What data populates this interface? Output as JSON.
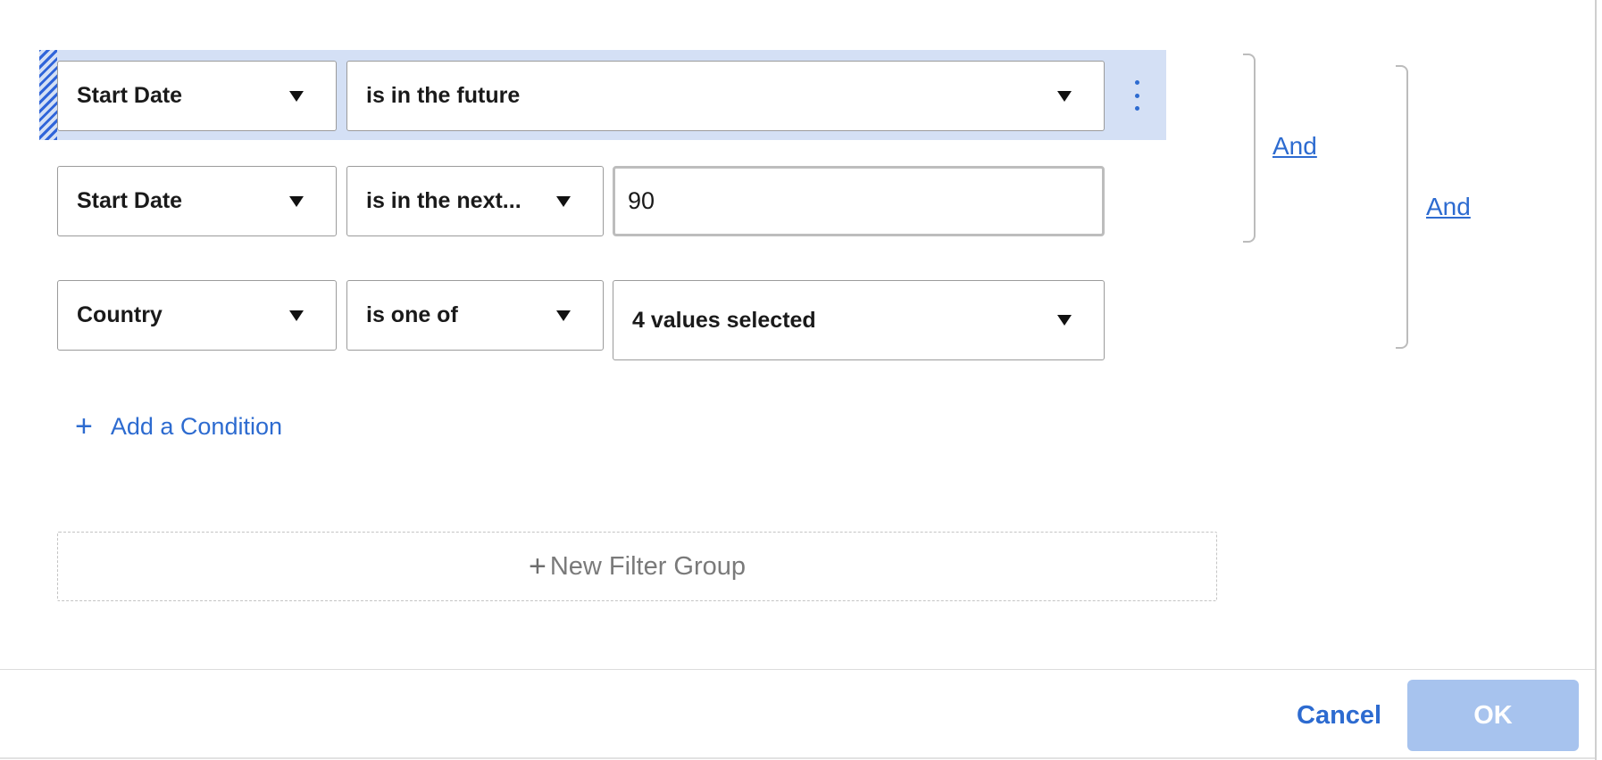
{
  "filters": {
    "conditions": [
      {
        "field": "Start Date",
        "operator": "is in the future"
      },
      {
        "field": "Start Date",
        "operator": "is in the next...",
        "value": "90"
      },
      {
        "field": "Country",
        "operator": "is one of",
        "value": "4 values selected"
      }
    ],
    "inner_logic": "And",
    "outer_logic": "And",
    "add_condition_label": "Add a Condition",
    "new_group_label": "New Filter Group"
  },
  "footer": {
    "cancel_label": "Cancel",
    "ok_label": "OK"
  },
  "colors": {
    "accent": "#2d6bd0",
    "selected_row": "#d4e0f5",
    "ok_disabled": "#a7c3ee"
  },
  "icons": [
    "drag-handle",
    "chevron-down-icon",
    "more-vertical-icon",
    "plus-icon"
  ]
}
